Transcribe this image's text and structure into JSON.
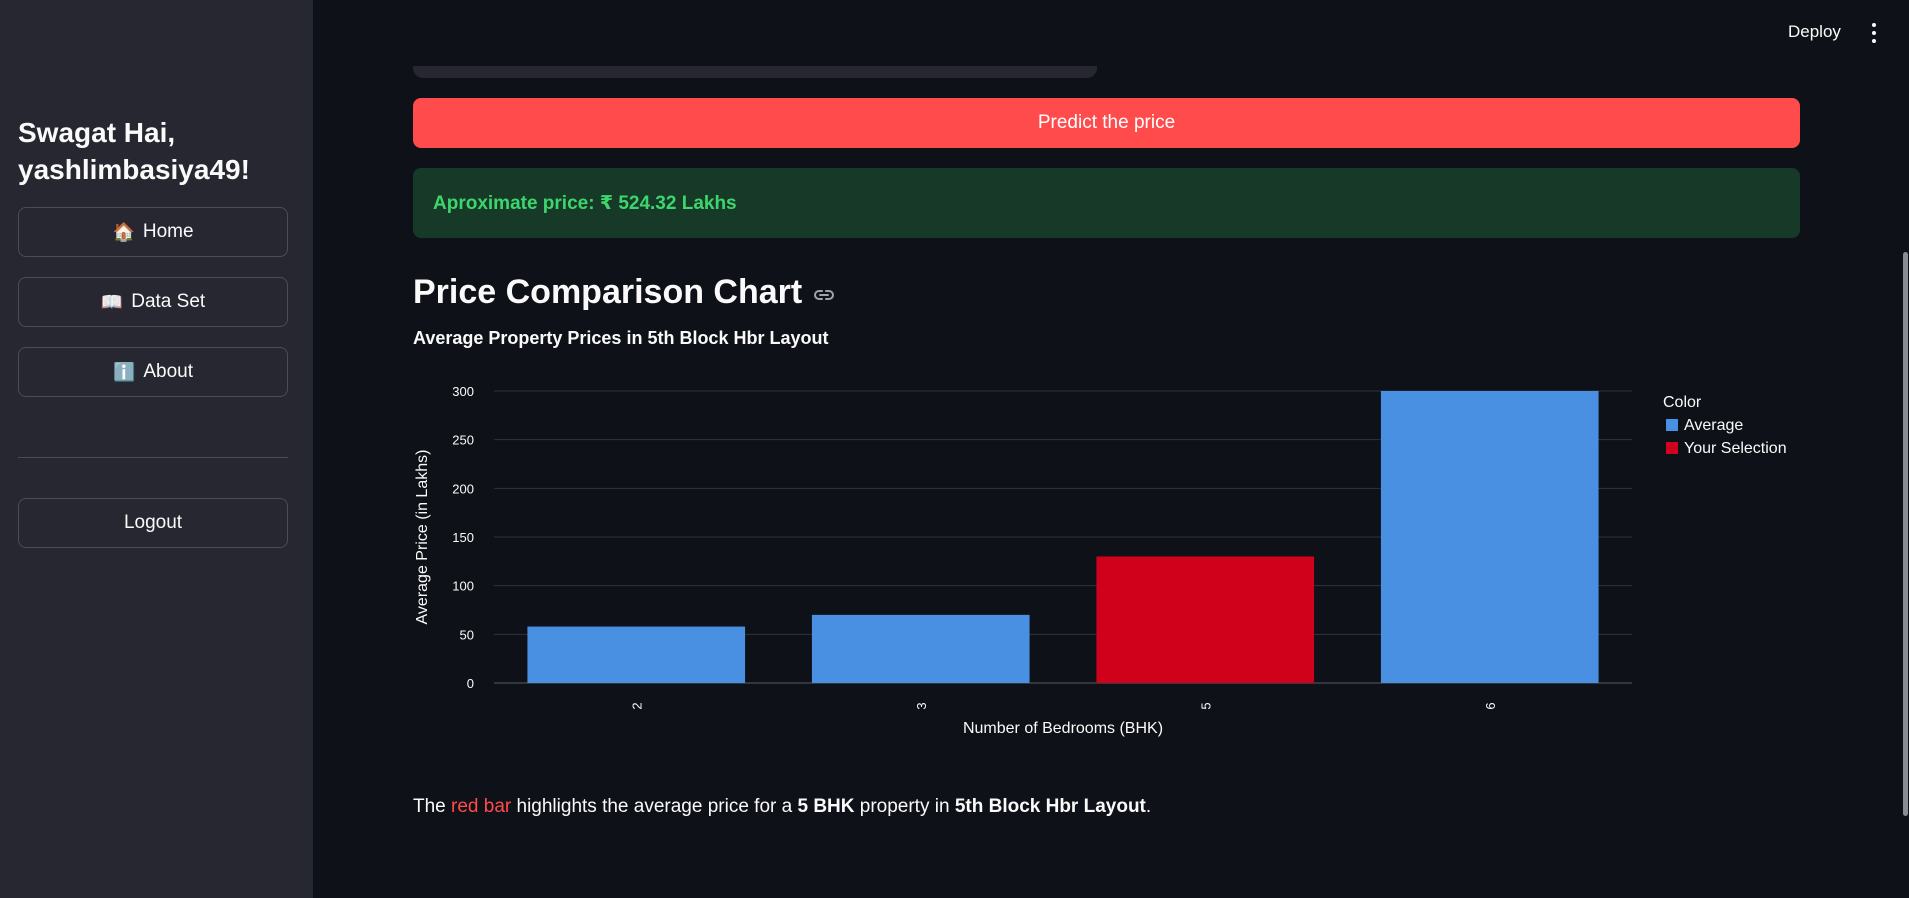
{
  "header": {
    "deploy_label": "Deploy",
    "menu_icon": "kebab-menu-icon"
  },
  "sidebar": {
    "greeting": "Swagat Hai, yashlimbasiya49!",
    "items": [
      {
        "icon": "🏠",
        "label": "Home"
      },
      {
        "icon": "📖",
        "label": "Data Set"
      },
      {
        "icon": "ℹ️",
        "label": "About"
      }
    ],
    "logout_label": "Logout"
  },
  "main": {
    "predict_label": "Predict the price",
    "result_text": "Aproximate price: ₹ 524.32 Lakhs",
    "section_title": "Price Comparison Chart",
    "caption": {
      "prefix": "The ",
      "red_text": "red bar",
      "middle1": " highlights the average price for a ",
      "bhk": "5 BHK",
      "middle2": " property in ",
      "location": "5th Block Hbr Layout",
      "suffix": "."
    }
  },
  "colors": {
    "primary": "#ff4b4b",
    "success_bg": "#173928",
    "success_text": "#3dd56d",
    "average_bar": "#4a90e2",
    "selection_bar": "#d0021b"
  },
  "chart_data": {
    "type": "bar",
    "title": "Average Property Prices in 5th Block Hbr Layout",
    "xlabel": "Number of Bedrooms (BHK)",
    "ylabel": "Average Price (in Lakhs)",
    "categories": [
      "2",
      "3",
      "5",
      "6"
    ],
    "values": [
      58,
      70,
      130,
      300
    ],
    "color_groups": [
      "Average",
      "Average",
      "Your Selection",
      "Average"
    ],
    "ylim": [
      0,
      300
    ],
    "yticks": [
      0,
      50,
      100,
      150,
      200,
      250,
      300
    ],
    "grid": true,
    "legend": {
      "title": "Color",
      "position": "right",
      "entries": [
        {
          "name": "Average",
          "color": "#4a90e2"
        },
        {
          "name": "Your Selection",
          "color": "#d0021b"
        }
      ]
    }
  }
}
